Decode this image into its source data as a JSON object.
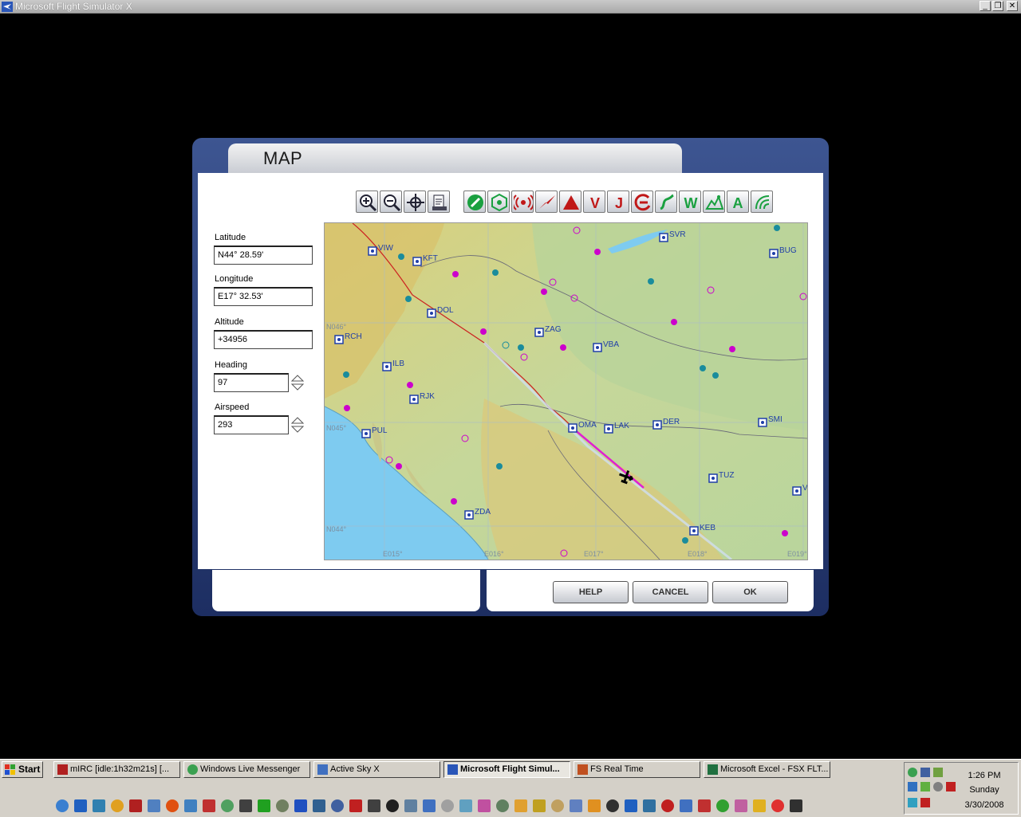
{
  "window": {
    "title": "Microsoft Flight Simulator X",
    "buttons": {
      "minimize": "_",
      "restore": "❐",
      "close": "✕"
    }
  },
  "dialog": {
    "title": "MAP",
    "fields": [
      {
        "label": "Latitude",
        "value": "N44° 28.59'"
      },
      {
        "label": "Longitude",
        "value": "E17° 32.53'"
      },
      {
        "label": "Altitude",
        "value": "+34956"
      },
      {
        "label": "Heading",
        "value": "97"
      },
      {
        "label": "Airspeed",
        "value": "293"
      }
    ],
    "toolbar": {
      "icons": [
        "zoom-in-icon",
        "zoom-out-icon",
        "center-icon",
        "print-icon",
        "airports-icon",
        "vor-icon",
        "ndb-icon",
        "intersections-icon",
        "airspace-icon",
        "victor-airways-icon",
        "jet-airways-icon",
        "approach-icon",
        "route-icon",
        "weather-icon",
        "terrain-icon",
        "labels-icon",
        "compass-icon"
      ],
      "letters": {
        "victor": "V",
        "jet": "J",
        "weather": "W",
        "labels": "A"
      }
    },
    "buttons": {
      "help": "HELP",
      "cancel": "CANCEL",
      "ok": "OK"
    }
  },
  "map": {
    "stations": [
      {
        "id": "VIW"
      },
      {
        "id": "KFT"
      },
      {
        "id": "SVR"
      },
      {
        "id": "BUG"
      },
      {
        "id": "DOL"
      },
      {
        "id": "ZAG"
      },
      {
        "id": "VBA"
      },
      {
        "id": "RCH"
      },
      {
        "id": "ILB"
      },
      {
        "id": "RJK"
      },
      {
        "id": "OMA"
      },
      {
        "id": "LAK"
      },
      {
        "id": "DER"
      },
      {
        "id": "SMI"
      },
      {
        "id": "PUL"
      },
      {
        "id": "TUZ"
      },
      {
        "id": "ZDA"
      },
      {
        "id": "KEB"
      },
      {
        "id": "V"
      }
    ],
    "grid_labels": [
      "N046°",
      "N045°",
      "N044°",
      "E015°",
      "E016°",
      "E017°",
      "E018°",
      "E019°"
    ]
  },
  "taskbar": {
    "start": "Start",
    "tasks": [
      "mIRC [idle:1h32m21s] [...",
      "Windows Live Messenger",
      "Active Sky X",
      "Microsoft Flight Simul...",
      "FS Real Time",
      "Microsoft Excel - FSX FLT..."
    ],
    "clock": {
      "time": "1:26 PM",
      "day": "Sunday",
      "date": "3/30/2008"
    }
  },
  "colors": {
    "dialog_frame": "#2a3f7a",
    "flight_plan": "#e020d0",
    "route": "#cc2020",
    "vor": "#1f3ea8",
    "ndb": "#cc00cc",
    "airport": "#1a8c9c"
  }
}
